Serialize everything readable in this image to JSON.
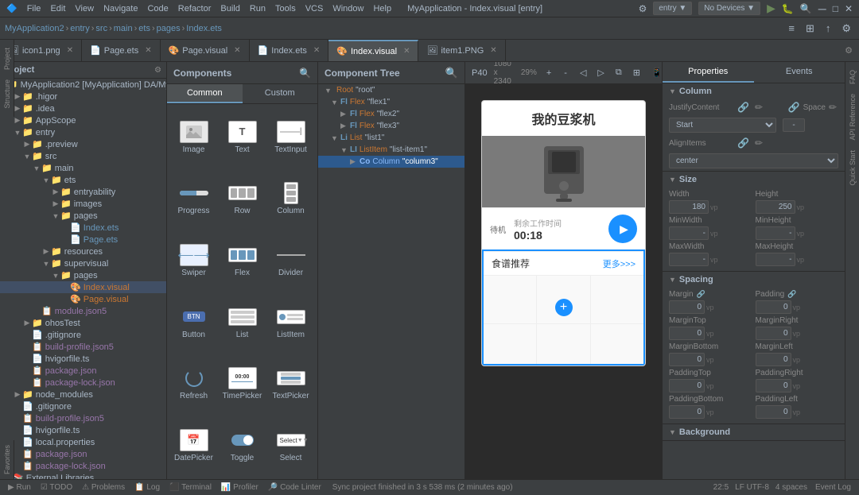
{
  "window": {
    "title": "MyApplication - Index.visual [entry]",
    "menus": [
      "File",
      "Edit",
      "View",
      "Navigate",
      "Code",
      "Refactor",
      "Build",
      "Run",
      "Tools",
      "VCS",
      "Window",
      "Help"
    ]
  },
  "toolbar2": {
    "breadcrumb": [
      "MyApplication2",
      "entry",
      "src",
      "main",
      "ets",
      "pages",
      "Index.ets"
    ]
  },
  "tabs": [
    {
      "label": "icon1.png",
      "active": false
    },
    {
      "label": "Page.ets",
      "active": false
    },
    {
      "label": "Page.visual",
      "active": false
    },
    {
      "label": "Index.ets",
      "active": false
    },
    {
      "label": "Index.visual",
      "active": true
    },
    {
      "label": "item1.PNG",
      "active": false
    }
  ],
  "canvas_toolbar": {
    "device": "P40",
    "resolution": "1080 x 2340",
    "zoom": "29%"
  },
  "components_panel": {
    "title": "Components",
    "tabs": [
      "Common",
      "Custom"
    ],
    "active_tab": "Common",
    "items": [
      {
        "label": "Image",
        "icon": "image"
      },
      {
        "label": "Text",
        "icon": "text"
      },
      {
        "label": "TextInput",
        "icon": "textinput"
      },
      {
        "label": "Progress",
        "icon": "progress"
      },
      {
        "label": "Row",
        "icon": "row"
      },
      {
        "label": "Column",
        "icon": "column"
      },
      {
        "label": "Swiper",
        "icon": "swiper"
      },
      {
        "label": "Flex",
        "icon": "flex"
      },
      {
        "label": "Divider",
        "icon": "divider"
      },
      {
        "label": "Button",
        "icon": "button"
      },
      {
        "label": "List",
        "icon": "list"
      },
      {
        "label": "ListItem",
        "icon": "listitem"
      },
      {
        "label": "Refresh",
        "icon": "refresh"
      },
      {
        "label": "TimePicker",
        "icon": "timepicker"
      },
      {
        "label": "TextPicker",
        "icon": "textpicker"
      },
      {
        "label": "DatePicker",
        "icon": "datepicker"
      },
      {
        "label": "Toggle",
        "icon": "toggle"
      },
      {
        "label": "Select",
        "icon": "select"
      }
    ]
  },
  "component_tree": {
    "title": "Component Tree",
    "items": [
      {
        "label": "Root",
        "type": "",
        "value": "\"root\"",
        "indent": 0,
        "expanded": true
      },
      {
        "label": "Flex",
        "type": "F",
        "value": "\"flex1\"",
        "indent": 1,
        "expanded": true
      },
      {
        "label": "Flex",
        "type": "F",
        "value": "\"flex2\"",
        "indent": 2,
        "expanded": false
      },
      {
        "label": "Flex",
        "type": "F",
        "value": "\"flex3\"",
        "indent": 2,
        "expanded": false
      },
      {
        "label": "List",
        "type": "L",
        "value": "\"list1\"",
        "indent": 1,
        "expanded": true
      },
      {
        "label": "ListItem",
        "type": "LI",
        "value": "\"list-item1\"",
        "indent": 2,
        "expanded": true
      },
      {
        "label": "Column",
        "type": "C",
        "value": "\"column3\"",
        "indent": 3,
        "expanded": false,
        "selected": true
      }
    ]
  },
  "canvas": {
    "device": "P40",
    "app_title": "我的豆浆机",
    "remaining_time_label": "剩余工作时间",
    "standby_label": "待机",
    "time_value": "00:18",
    "food_recommend": "食谱推荐",
    "more_label": "更多>>>"
  },
  "properties": {
    "tabs": [
      "Properties",
      "Events"
    ],
    "active_tab": "Properties",
    "sections": {
      "column": {
        "title": "Column",
        "justify_content": {
          "label": "JustifyContent",
          "value": "Start"
        },
        "space": {
          "label": "Space",
          "value": "- -"
        },
        "align_items": {
          "label": "AlignItems",
          "value": "center"
        }
      },
      "size": {
        "title": "Size",
        "width": {
          "label": "Width",
          "value": "180",
          "unit": "vp"
        },
        "height": {
          "label": "Height",
          "value": "250",
          "unit": "vp"
        },
        "min_width": {
          "label": "MinWidth",
          "value": "-",
          "unit": "vp"
        },
        "min_height": {
          "label": "MinHeight",
          "value": "-",
          "unit": "vp"
        },
        "max_width": {
          "label": "MaxWidth",
          "value": "-",
          "unit": "vp"
        },
        "max_height": {
          "label": "MaxHeight",
          "value": "-",
          "unit": "vp"
        }
      },
      "spacing": {
        "title": "Spacing",
        "margin": {
          "label": "Margin",
          "value": "0",
          "unit": "vp"
        },
        "padding": {
          "label": "Padding",
          "value": "0",
          "unit": "vp"
        },
        "margin_top": {
          "label": "MarginTop",
          "value": "0",
          "unit": "vp"
        },
        "margin_right": {
          "label": "MarginRight",
          "value": "0",
          "unit": "vp"
        },
        "margin_bottom": {
          "label": "MarginBottom",
          "value": "0",
          "unit": "vp"
        },
        "margin_left": {
          "label": "MarginLeft",
          "value": "0",
          "unit": "vp"
        },
        "padding_top": {
          "label": "PaddingTop",
          "value": "0",
          "unit": "vp"
        },
        "padding_right": {
          "label": "PaddingRight",
          "value": "0",
          "unit": "vp"
        },
        "padding_bottom": {
          "label": "PaddingBottom",
          "value": "0",
          "unit": "vp"
        },
        "padding_left": {
          "label": "PaddingLeft",
          "value": "0",
          "unit": "vp"
        }
      },
      "background": {
        "title": "Background"
      }
    }
  },
  "statusbar": {
    "run_label": "Run",
    "todo_label": "TODO",
    "problems_label": "Problems",
    "log_label": "Log",
    "terminal_label": "Terminal",
    "profiler_label": "Profiler",
    "codelinter_label": "Code Linter",
    "sync_message": "Sync project finished in 3 s 538 ms (2 minutes ago)",
    "line_col": "22:5",
    "encoding": "LF UTF-8",
    "spaces": "4 spaces",
    "event_log": "Event Log"
  },
  "colors": {
    "accent": "#6897bb",
    "bg_dark": "#2b2b2b",
    "bg_mid": "#3c3f41",
    "bg_light": "#4e5254",
    "selected": "#2d5a8e",
    "text_primary": "#a9b7c6",
    "text_dim": "#888888"
  }
}
